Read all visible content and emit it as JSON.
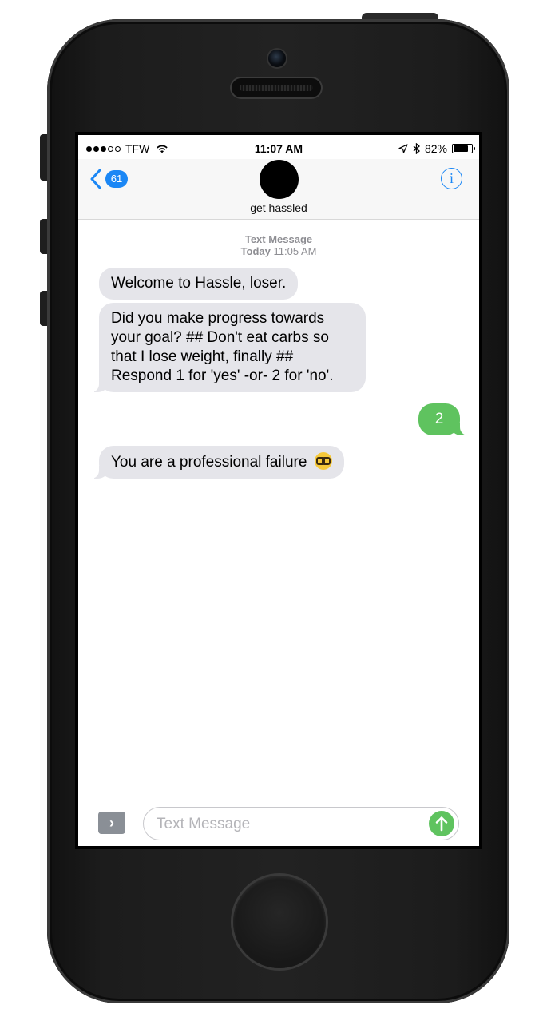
{
  "status_bar": {
    "carrier": "TFW",
    "time": "11:07 AM",
    "battery_text": "82%",
    "battery_level": 0.82,
    "signal_filled": 3,
    "signal_total": 5
  },
  "header": {
    "back_count": "61",
    "contact_name": "get hassled",
    "info_glyph": "i"
  },
  "conversation": {
    "service": "Text Message",
    "day": "Today",
    "time": "11:05 AM",
    "messages": [
      {
        "direction": "incoming",
        "text": "Welcome to Hassle, loser."
      },
      {
        "direction": "incoming",
        "text": "Did you make progress towards your goal? ## Don't eat carbs so that I lose weight, finally ## Respond 1 for 'yes' -or- 2 for 'no'."
      },
      {
        "direction": "outgoing",
        "text": "2"
      },
      {
        "direction": "incoming",
        "text": "You are a professional failure",
        "emoji": "nerd-face-icon"
      }
    ]
  },
  "input_bar": {
    "expand_glyph": "›",
    "placeholder": "Text Message"
  },
  "colors": {
    "ios_blue": "#1b87f5",
    "imessage_incoming": "#e5e5ea",
    "sms_outgoing_green": "#5fc35f"
  }
}
